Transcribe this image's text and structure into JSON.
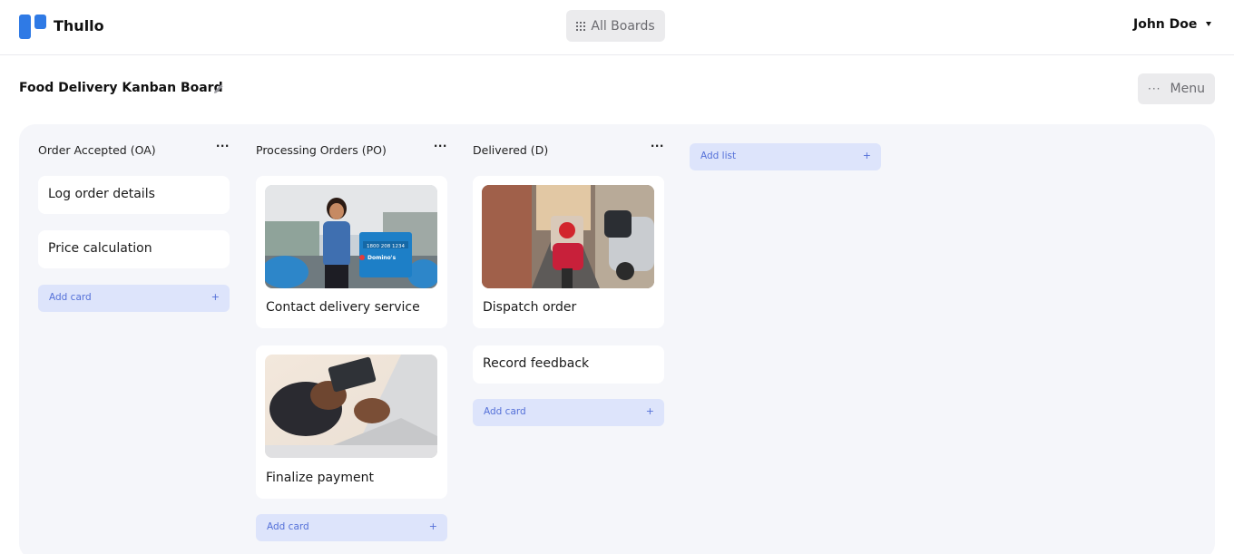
{
  "header": {
    "app_name": "Thullo",
    "all_boards_label": "All Boards",
    "user_name": "John Doe"
  },
  "board": {
    "title": "Food Delivery Kanban Board",
    "menu_label": "Menu"
  },
  "lists": [
    {
      "title": "Order Accepted (OA)",
      "menu": "···",
      "cards": [
        {
          "text": "Log order details"
        },
        {
          "text": "Price calculation"
        }
      ],
      "add_card_label": "Add card",
      "add_icon": "+"
    },
    {
      "title": "Processing Orders (PO)",
      "menu": "···",
      "cards": [
        {
          "text": "Contact delivery service",
          "image": "delivery-person-photo",
          "image_text_1": "1800 208 1234",
          "image_text_2": "Domino's"
        },
        {
          "text": "Finalize payment",
          "image": "card-payment-laptop-photo"
        }
      ],
      "add_card_label": "Add card",
      "add_icon": "+"
    },
    {
      "title": "Delivered (D)",
      "menu": "···",
      "cards": [
        {
          "text": "Dispatch order",
          "image": "delivery-bike-street-photo"
        },
        {
          "text": "Record feedback"
        }
      ],
      "add_card_label": "Add card",
      "add_icon": "+"
    }
  ],
  "add_list": {
    "label": "Add list",
    "icon": "+"
  },
  "colors": {
    "brand": "#2f7ae5",
    "add_button_bg": "#dde4fb",
    "add_button_text": "#5470d8",
    "board_bg": "#f5f6fa"
  }
}
